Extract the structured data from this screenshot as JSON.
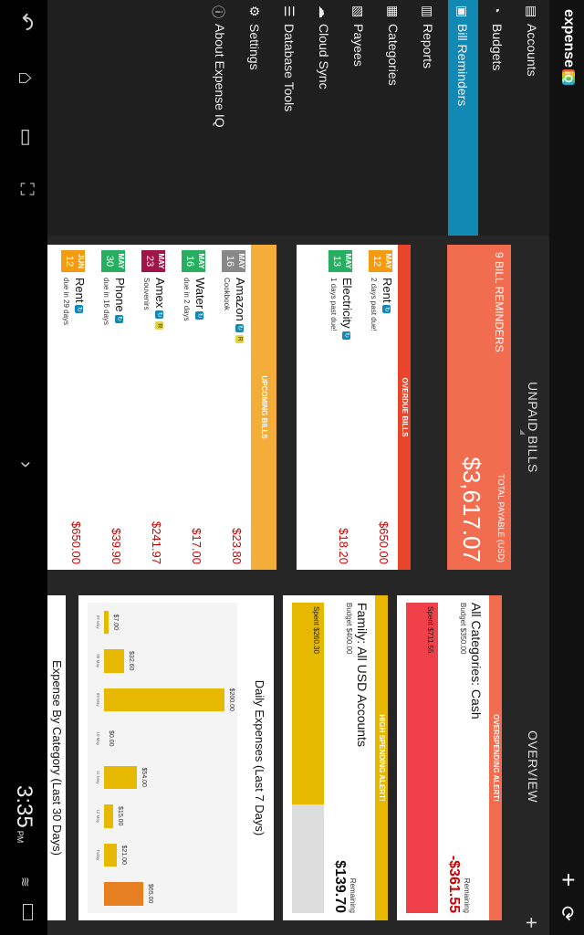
{
  "status_bar": {
    "time": "3:35",
    "ampm": "PM"
  },
  "app": {
    "logo_text": "expense",
    "logo_suffix": "iQ"
  },
  "drawer": {
    "items": [
      {
        "label": "Accounts",
        "icon": "accounts-icon"
      },
      {
        "label": "Budgets",
        "icon": "budgets-icon"
      },
      {
        "label": "Bill Reminders",
        "icon": "bill-reminders-icon",
        "selected": true
      },
      {
        "label": "Reports",
        "icon": "reports-icon"
      },
      {
        "label": "Categories",
        "icon": "categories-icon"
      },
      {
        "label": "Payees",
        "icon": "payees-icon"
      },
      {
        "label": "Cloud Sync",
        "icon": "cloud-icon"
      },
      {
        "label": "Database Tools",
        "icon": "database-icon"
      },
      {
        "label": "Settings",
        "icon": "settings-icon"
      },
      {
        "label": "About Expense IQ",
        "icon": "about-icon"
      }
    ]
  },
  "unpaid": {
    "title": "UNPAID BILLS",
    "summary": {
      "count_label": "9 BILL REMINDERS",
      "total_label": "TOTAL PAYABLE (USD)",
      "total": "$3,617.07"
    },
    "overdue": {
      "header": "OVERDUE BILLS",
      "bills": [
        {
          "month": "MAY",
          "day": "12",
          "name": "Rent",
          "sub": "2 days past due!",
          "amount": "$650.00",
          "color": "#f39c12"
        },
        {
          "month": "MAY",
          "day": "13",
          "name": "Electricity",
          "sub": "1 days past due!",
          "amount": "$18.20",
          "color": "#27ae60"
        }
      ]
    },
    "upcoming": {
      "header": "UPCOMING BILLS",
      "bills": [
        {
          "month": "MAY",
          "day": "16",
          "name": "Amazon",
          "sub": "Cookbook",
          "amount": "$23.80",
          "color": "#888888",
          "tag": "R"
        },
        {
          "month": "MAY",
          "day": "16",
          "name": "Water",
          "sub": "due in 2 days",
          "amount": "$17.00",
          "color": "#27ae60"
        },
        {
          "month": "MAY",
          "day": "23",
          "name": "Amex",
          "sub": "Souvenirs",
          "amount": "$241.97",
          "color": "#a0144a",
          "tag": "R"
        },
        {
          "month": "MAY",
          "day": "30",
          "name": "Phone",
          "sub": "due in 16 days",
          "amount": "$39.90",
          "color": "#27ae60"
        },
        {
          "month": "JUN",
          "day": "12",
          "name": "Rent",
          "sub": "due in 29 days",
          "amount": "$650.00",
          "color": "#f39c12"
        }
      ]
    }
  },
  "overview": {
    "title": "OVERVIEW",
    "overspending": {
      "header": "OVERSPENDING ALERT!",
      "name": "All Categories: Cash",
      "budget": "Budget $350.00",
      "spent": "Spent $711.55",
      "remaining_label": "Remaining",
      "remaining": "-$361.55",
      "spent_fraction": 1.0
    },
    "high_spending": {
      "header": "HIGH SPENDING ALERT!",
      "name": "Family: All USD Accounts",
      "budget": "Budget $400.00",
      "spent": "Spent $260.30",
      "remaining_label": "Remaining",
      "remaining": "$139.70",
      "spent_fraction": 0.65
    },
    "daily_chart": {
      "title": "Daily Expenses (Last 7 Days)"
    },
    "category_chart": {
      "title": "Expense By Category (Last 30 Days)"
    }
  },
  "chart_data": {
    "type": "bar",
    "title": "Daily Expenses (Last 7 Days)",
    "categories": [
      "07 May",
      "08 May",
      "09 May",
      "10 May",
      "11 May",
      "12 May",
      "Today"
    ],
    "values": [
      7.0,
      32.6,
      200.0,
      0.0,
      54.0,
      15.0,
      21.0,
      65.0
    ],
    "value_labels": [
      "$7.00",
      "$32.60",
      "$200.00",
      "$0.00",
      "$54.00",
      "$15.00",
      "$21.00",
      "$65.00"
    ],
    "ylim": [
      0,
      200
    ]
  },
  "colors": {
    "accent": "#1089b4",
    "overdue": "#e8452a",
    "upcoming": "#f5ad3a",
    "summary": "#f26c4f",
    "overspend": "#f26c4f",
    "high_spend": "#e6b800"
  }
}
